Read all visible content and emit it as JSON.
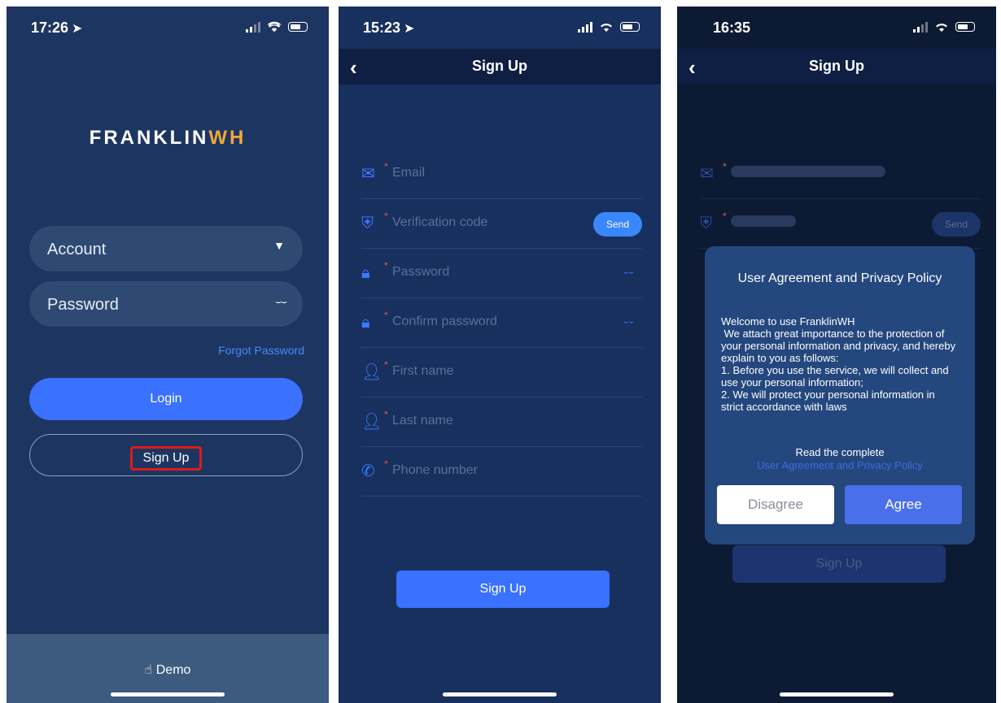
{
  "screen1": {
    "time": "17:26",
    "logo": {
      "part1": "FRANKLIN",
      "part2": "WH"
    },
    "account_placeholder": "Account",
    "password_placeholder": "Password",
    "forgot_password": "Forgot Password",
    "login_button": "Login",
    "signup_button": "Sign Up",
    "demo_label": "Demo"
  },
  "screen2": {
    "time": "15:23",
    "title": "Sign Up",
    "fields": [
      {
        "icon": "envelope-icon",
        "placeholder": "Email"
      },
      {
        "icon": "shield-check-icon",
        "placeholder": "Verification code"
      },
      {
        "icon": "lock-icon",
        "placeholder": "Password"
      },
      {
        "icon": "lock-icon",
        "placeholder": "Confirm password"
      },
      {
        "icon": "person-icon",
        "placeholder": "First name"
      },
      {
        "icon": "person-icon",
        "placeholder": "Last name"
      },
      {
        "icon": "phone-icon",
        "placeholder": "Phone number"
      }
    ],
    "send_button": "Send",
    "signup_button": "Sign Up"
  },
  "screen3": {
    "time": "16:35",
    "title": "Sign Up",
    "send_button": "Send",
    "signup_button": "Sign Up",
    "modal": {
      "title": "User Agreement and Privacy Policy",
      "body": "Welcome to use FranklinWH\n We attach great importance to the protection of your personal information and privacy, and hereby explain to you as follows:\n1. Before you use the service, we will collect and use your personal information;\n2. We will protect your personal information in strict accordance with laws",
      "read_complete": "Read the complete",
      "link": "User Agreement and Privacy Policy",
      "disagree": "Disagree",
      "agree": "Agree"
    }
  },
  "colors": {
    "accent": "#3a71ff",
    "logo_wh": "#f0a83a",
    "required": "#ff4d4d"
  }
}
